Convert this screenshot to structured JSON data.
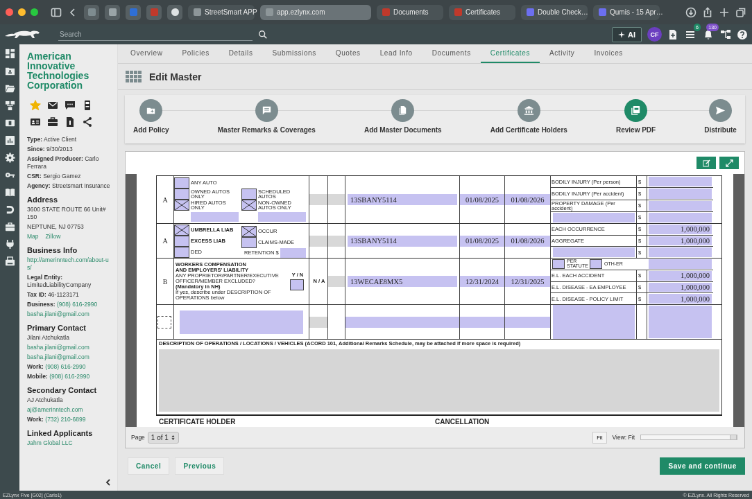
{
  "browser": {
    "tabs": [
      {
        "label": "StreetSmart APP",
        "selected": false
      },
      {
        "label": "app.ezlynx.com",
        "selected": true
      },
      {
        "label": "Documents",
        "selected": false
      },
      {
        "label": "Certificates",
        "selected": false
      },
      {
        "label": "Double Check…",
        "selected": false
      },
      {
        "label": "Qumis - 15 Apr…",
        "selected": false
      }
    ]
  },
  "header": {
    "search": {
      "placeholder": "Search"
    },
    "ai_button": "AI",
    "avatar": "CF",
    "badges": [
      {
        "count": "6",
        "color": "#1f8a67"
      },
      {
        "count": "130",
        "color": "#7d4fc8"
      }
    ]
  },
  "client": {
    "name": "American Innovative Technologies Corporation",
    "favorite": true,
    "sections": [
      {
        "lines": [
          {
            "label": "Type:",
            "value": "Active Client"
          },
          {
            "label": "Since:",
            "value": "9/30/2013"
          },
          {
            "label": "Assigned Producer:",
            "value": "Carlo Ferrara"
          },
          {
            "label": "CSR:",
            "value": "Sergio Gamez"
          },
          {
            "label": "Agency:",
            "value": "Streetsmart Insurance"
          }
        ]
      },
      {
        "title": "Address",
        "lines": [
          {
            "value": "3600 STATE ROUTE 66 Unit# 150"
          },
          {
            "value": "NEPTUNE, NJ 07753"
          },
          {
            "links": [
              "Map",
              "Zillow"
            ]
          }
        ]
      },
      {
        "title": "Business Info",
        "lines": [
          {
            "value": "http://amerinntech.com/about-us/",
            "link": true
          },
          {
            "label": "Legal Entity:",
            "value": "LimitedLiabilityCompany"
          },
          {
            "label": "Tax ID:",
            "value": "46-1123171"
          },
          {
            "label": "Business:",
            "value": "(908) 616-2990",
            "link": true
          },
          {
            "value": "basha.jilani@gmail.com",
            "link": true
          }
        ]
      },
      {
        "title": "Primary Contact",
        "lines": [
          {
            "value": "Jilani Atchukatla"
          },
          {
            "value": "basha.jilani@gmail.com",
            "link": true
          },
          {
            "value": "basha.jilani@gmail.com",
            "link": true
          },
          {
            "label": "Work:",
            "value": "(908) 616-2990",
            "link": true
          },
          {
            "label": "Mobile:",
            "value": "(908) 616-2990",
            "link": true
          }
        ]
      },
      {
        "title": "Secondary Contact",
        "lines": [
          {
            "value": "AJ Atchukatla"
          },
          {
            "value": "aj@amerinntech.com",
            "link": true
          },
          {
            "label": "Work:",
            "value": "(732) 210-6899",
            "link": true
          }
        ]
      },
      {
        "title": "Linked Applicants",
        "lines": [
          {
            "value": "Jahm Global LLC",
            "link": true
          }
        ]
      }
    ]
  },
  "nav_tabs": [
    {
      "label": "Overview",
      "selected": false
    },
    {
      "label": "Policies",
      "selected": false
    },
    {
      "label": "Details",
      "selected": false
    },
    {
      "label": "Submissions",
      "selected": false
    },
    {
      "label": "Quotes",
      "selected": false
    },
    {
      "label": "Lead Info",
      "selected": false
    },
    {
      "label": "Documents",
      "selected": false
    },
    {
      "label": "Certificates",
      "selected": true
    },
    {
      "label": "Activity",
      "selected": false
    },
    {
      "label": "Invoices",
      "selected": false
    }
  ],
  "page_title": "Edit Master",
  "steps": [
    {
      "label": "Add Policy",
      "selected": false
    },
    {
      "label": "Master Remarks & Coverages",
      "selected": false
    },
    {
      "label": "Add Master Documents",
      "selected": false
    },
    {
      "label": "Add Certificate Holders",
      "selected": false
    },
    {
      "label": "Review PDF",
      "selected": true
    },
    {
      "label": "Distribute",
      "selected": false
    }
  ],
  "form": {
    "rows": [
      {
        "kind": "auto",
        "ltr": "A",
        "policy_number": "13SBANY5114",
        "effective": "01/08/2025",
        "expiration": "01/08/2026",
        "coverage": [
          [
            {
              "kind": "check",
              "label": "ANY AUTO",
              "checked": false
            },
            {
              "kind": "check",
              "label": "OWNED AUTOS ONLY",
              "checked": false
            },
            {
              "kind": "check",
              "label": "HIRED AUTOS ONLY",
              "checked": true
            },
            {
              "kind": "field"
            }
          ],
          [
            {
              "kind": "check",
              "label": "SCHEDULED AUTOS",
              "checked": false
            },
            {
              "kind": "check",
              "label": "NON-OWNED AUTOS ONLY",
              "checked": true
            },
            {
              "kind": "field"
            }
          ]
        ],
        "limits": [
          {
            "kind": "limit",
            "label": "BODILY INJURY (Per person)",
            "currency": "$"
          },
          {
            "kind": "limit",
            "label": "BODILY INJURY (Per accident)",
            "currency": "$"
          },
          {
            "kind": "limit",
            "label": "PROPERTY DAMAGE (Per accident)",
            "currency": "$"
          },
          {
            "kind": "blank",
            "currency": "$"
          }
        ]
      },
      {
        "kind": "umbrella",
        "ltr": "A",
        "policy_number": "13SBANY5114",
        "effective": "01/08/2025",
        "expiration": "01/08/2026",
        "coverage": [
          [
            {
              "kind": "check",
              "label": "UMBRELLA LIAB",
              "checked": true,
              "bold": true
            },
            {
              "kind": "check",
              "label": "EXCESS LIAB",
              "checked": false,
              "bold": true
            },
            {
              "kind": "check",
              "label": "DED",
              "checked": false
            }
          ],
          [
            {
              "kind": "check",
              "label": "OCCUR",
              "checked": true
            },
            {
              "kind": "check",
              "label": "CLAIMS-MADE",
              "checked": false
            },
            {
              "kind": "labeled_field",
              "label": "RETENTION $"
            }
          ]
        ],
        "limits": [
          {
            "kind": "limit",
            "label": "EACH OCCURRENCE",
            "value": "1,000,000",
            "currency": "$"
          },
          {
            "kind": "limit",
            "label": "AGGREGATE",
            "value": "1,000,000",
            "currency": "$"
          },
          {
            "kind": "blank",
            "currency": "$"
          }
        ]
      },
      {
        "kind": "workers",
        "ltr": "B",
        "addl": "N / A",
        "policy_number": "13WECAE8MX5",
        "effective": "12/31/2024",
        "expiration": "12/31/2025",
        "coverage": [
          [
            {
              "kind": "text",
              "text": "WORKERS COMPENSATION",
              "bold": true
            },
            {
              "kind": "text",
              "text": "AND EMPLOYERS' LIABILITY",
              "bold": true
            },
            {
              "kind": "text",
              "text": "ANY PROPRIETOR/PARTNER/EXECUTIVE OFFICER/MEMBER EXCLUDED?",
              "bold": false
            },
            {
              "kind": "text",
              "text": "(Mandatory in NH)",
              "bold": true
            },
            {
              "kind": "text",
              "text": "If yes, describe under DESCRIPTION OF OPERATIONS below",
              "bold": false
            }
          ],
          [
            {
              "kind": "yn",
              "label": "Y / N",
              "checked": false
            }
          ]
        ],
        "limits": [
          {
            "kind": "statute",
            "checks": [
              {
                "label": "PER STATUTE",
                "checked": false
              },
              {
                "label": "OTH-ER",
                "checked": false
              }
            ]
          },
          {
            "kind": "limit",
            "label": "E.L. EACH ACCIDENT",
            "value": "1,000,000",
            "currency": "$"
          },
          {
            "kind": "limit",
            "label": "E.L. DISEASE - EA EMPLOYEE",
            "value": "1,000,000",
            "currency": "$"
          },
          {
            "kind": "limit",
            "label": "E.L. DISEASE - POLICY LIMIT",
            "value": "1,000,000",
            "currency": "$"
          }
        ]
      },
      {
        "kind": "blank"
      }
    ],
    "description_heading": "DESCRIPTION OF OPERATIONS / LOCATIONS / VEHICLES  (ACORD 101, Additional Remarks Schedule, may be attached if more space is required)",
    "footer_labels": [
      "CERTIFICATE HOLDER",
      "CANCELLATION"
    ]
  },
  "viewer": {
    "page_label": "Page",
    "page_select": "1 of 1",
    "fit_button": "Fit",
    "view_label": "View: Fit",
    "zoom": {
      "level": 1
    }
  },
  "buttons": [
    {
      "label": "Cancel",
      "kind": "secondary"
    },
    {
      "label": "Previous",
      "kind": "secondary"
    },
    {
      "label": "Save and continue",
      "kind": "primary"
    }
  ],
  "status_bar": {
    "left": "EZLynx Five [G02] (Carlo1)",
    "right": "© EZLynx. All Rights Reserved"
  }
}
